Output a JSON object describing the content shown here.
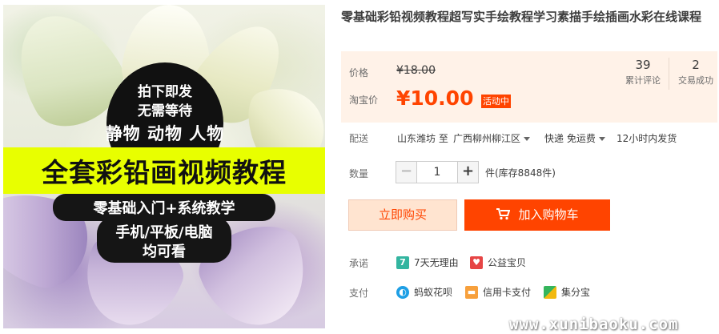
{
  "product": {
    "title": "零基础彩铅视频教程超写实手绘教程学习素描手绘插画水彩在线课程"
  },
  "hero_image": {
    "line1": "拍下即发",
    "line2": "无需等待",
    "line3": "静物  动物  人物",
    "headline": "全套彩铅画视频教程",
    "line5": "零基础入门+系统教学",
    "line6": "手机/平板/电脑",
    "line7": "均可看",
    "banner_color": "#e8ff00"
  },
  "price": {
    "price_label": "价格",
    "original_price": "¥18.00",
    "taobao_label": "淘宝价",
    "current_price": "¥10.00",
    "promo_badge": "活动中",
    "accent_color": "#ff4400"
  },
  "stats": {
    "reviews_count": "39",
    "reviews_label": "累计评论",
    "trades_count": "2",
    "trades_label": "交易成功"
  },
  "shipping": {
    "label": "配送",
    "from": "山东潍坊 至",
    "to": "广西柳州柳江区",
    "method": "快递 免运费",
    "dispatch": "12小时内发货"
  },
  "quantity": {
    "label": "数量",
    "value": "1",
    "minus": "−",
    "plus": "+",
    "stock": "件(库存8848件)"
  },
  "actions": {
    "buy_now": "立即购买",
    "add_to_cart": "加入购物车"
  },
  "promise": {
    "label": "承诺",
    "items": [
      {
        "icon": "seven-day-return-icon",
        "glyph": "7",
        "text": "7天无理由"
      },
      {
        "icon": "charity-icon",
        "glyph": "♥",
        "text": "公益宝贝"
      }
    ]
  },
  "payment": {
    "label": "支付",
    "items": [
      {
        "icon": "huabei-icon",
        "glyph": "◐",
        "text": "蚂蚁花呗"
      },
      {
        "icon": "credit-card-icon",
        "glyph": "▬",
        "text": "信用卡支付"
      },
      {
        "icon": "jifenbao-icon",
        "glyph": "",
        "text": "集分宝"
      }
    ]
  },
  "watermark": "www.xunibaoku.com"
}
